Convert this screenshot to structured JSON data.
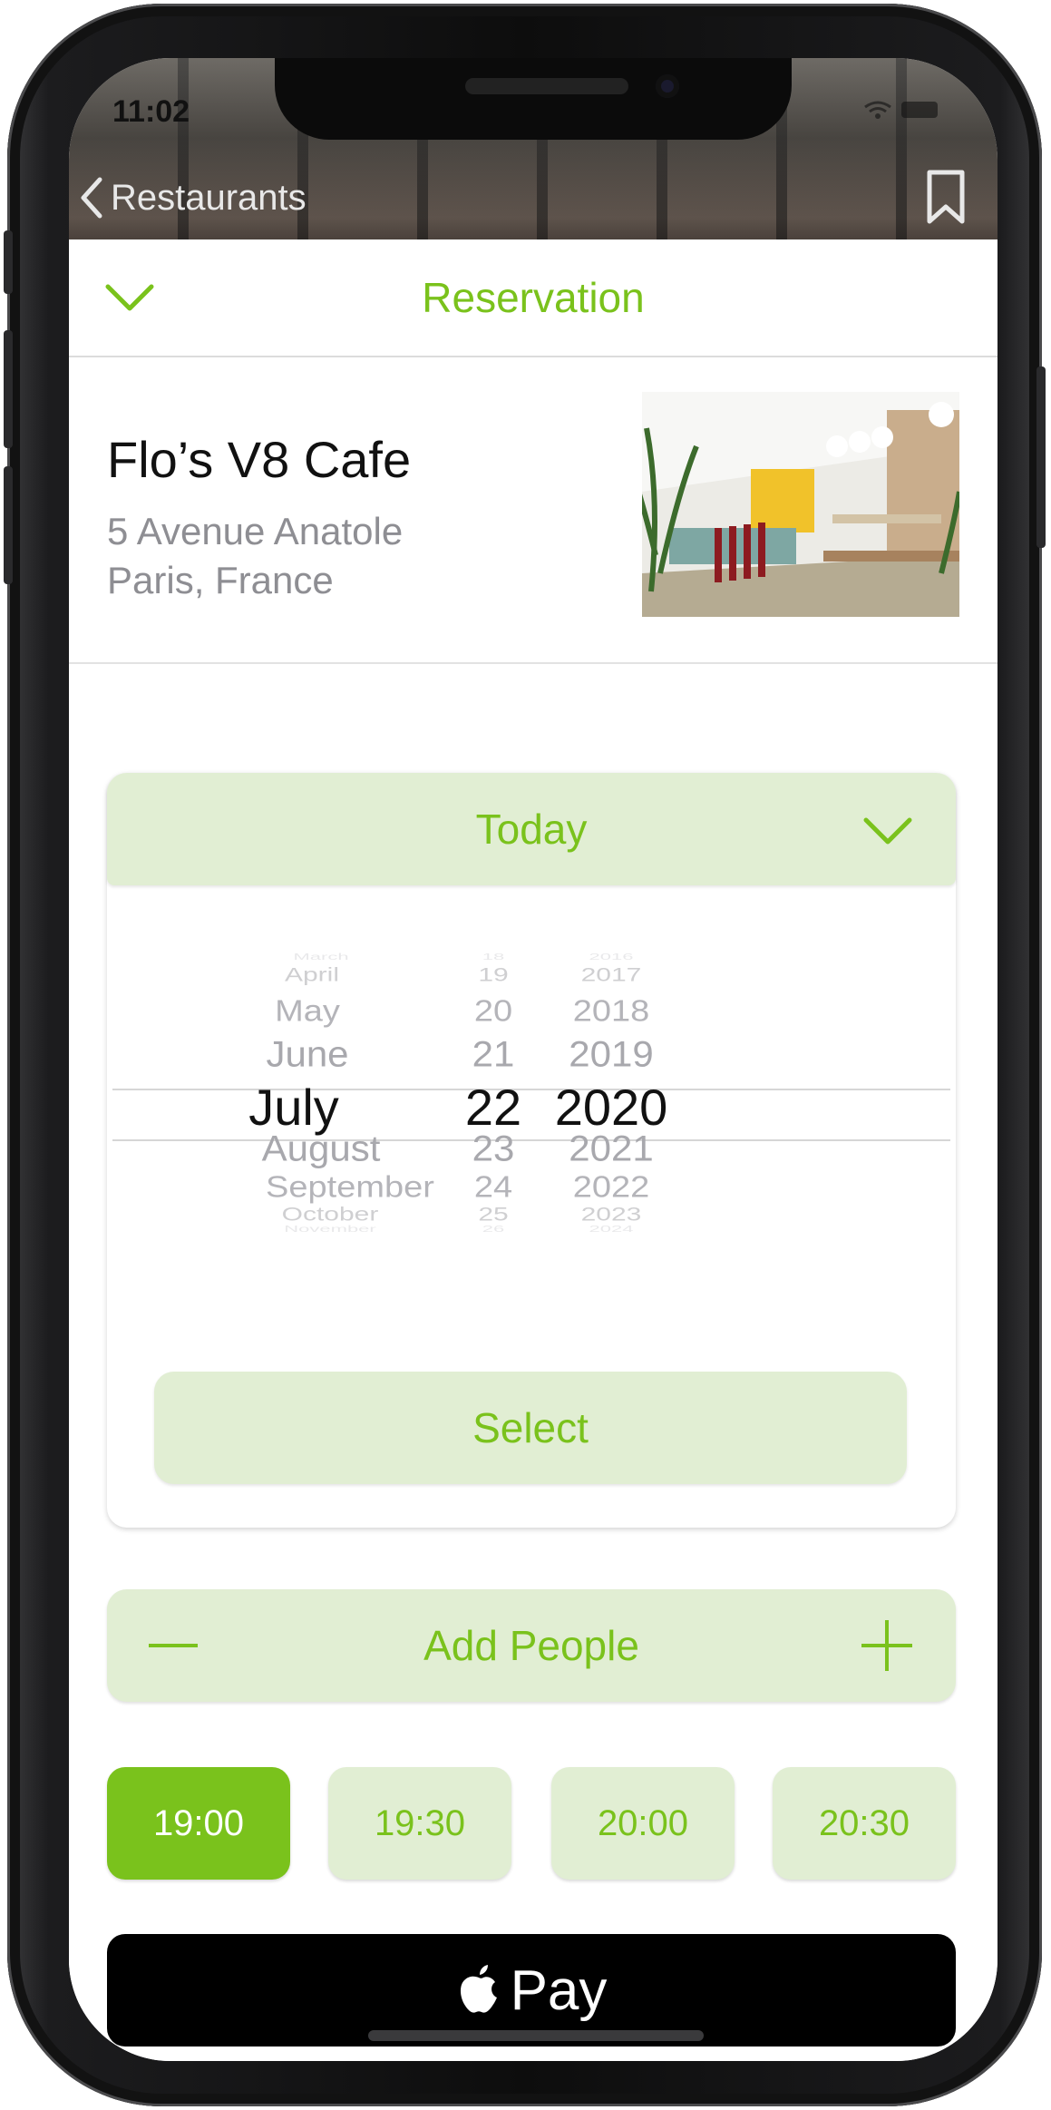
{
  "status_bar": {
    "time": "11:02"
  },
  "nav": {
    "back_label": "Restaurants"
  },
  "sheet": {
    "title": "Reservation"
  },
  "restaurant": {
    "name": "Flo’s V8 Cafe",
    "address_line1": "5 Avenue Anatole",
    "address_line2": "Paris, France"
  },
  "date_picker": {
    "title": "Today",
    "months": [
      "March",
      "April",
      "May",
      "June",
      "July",
      "August",
      "September",
      "October",
      "November"
    ],
    "days": [
      "18",
      "19",
      "20",
      "21",
      "22",
      "23",
      "24",
      "25",
      "26"
    ],
    "years": [
      "2016",
      "2017",
      "2018",
      "2019",
      "2020",
      "2021",
      "2022",
      "2023",
      "2024"
    ],
    "selected": {
      "month": "July",
      "day": "22",
      "year": "2020"
    },
    "select_label": "Select"
  },
  "people": {
    "label": "Add People"
  },
  "times": {
    "selected": "19:00",
    "slots": [
      "19:00",
      "19:30",
      "20:00",
      "20:30"
    ]
  },
  "payment": {
    "label": "Pay"
  },
  "colors": {
    "accent": "#7ac21c",
    "accent_light": "#e1eed3",
    "text_secondary": "#8e8e93"
  },
  "icons": {
    "back": "chevron-left-icon",
    "bookmark": "bookmark-icon",
    "collapse": "chevron-down-icon",
    "minus": "minus-icon",
    "plus": "plus-icon",
    "apple": "apple-logo-icon"
  }
}
